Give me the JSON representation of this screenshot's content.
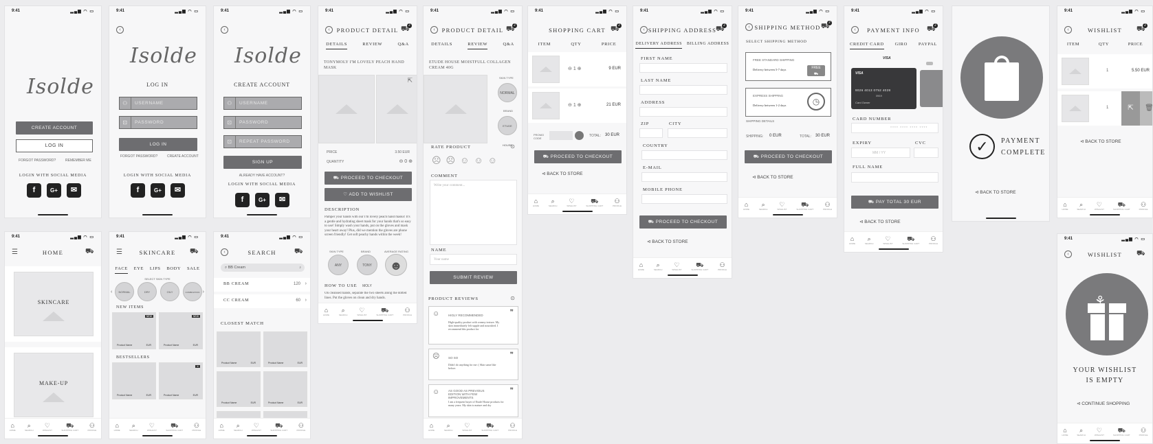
{
  "status_time": "9:41",
  "nav": [
    "HOME",
    "SEARCH",
    "WISHLIST",
    "SHOPPING CART",
    "PROFILE"
  ],
  "splash": {
    "logo": "Isolde",
    "create": "CREATE ACCOUNT",
    "login": "LOG IN",
    "forgot": "FORGOT PASSWORD?",
    "remember": "REMEMBER ME",
    "social": "LOGIN WITH SOCIAL MEDIA"
  },
  "login": {
    "title": "LOG IN",
    "username": "USERNAME",
    "password": "PASSWORD",
    "button": "LOG IN",
    "forgot": "FORGOT PASSWORD?",
    "create": "CREATE ACCOUNT",
    "social": "LOGIN WITH SOCIAL MEDIA"
  },
  "signup": {
    "title": "CREATE ACCOUNT",
    "username": "USERNAME",
    "password": "PASSWORD",
    "repeat": "REPEAT PASSWORD",
    "button": "SIGN UP",
    "already": "ALREADY HAVE ACCOUNT?",
    "social": "LOGIN WITH SOCIAL MEDIA"
  },
  "pd1": {
    "title": "PRODUCT DETAIL",
    "tabs": [
      "DETAILS",
      "REVIEW",
      "Q&A"
    ],
    "name": "TONYMOLY I'M LOVELY PEACH HAND MASK",
    "price_l": "PRICE",
    "price": "3.50 EUR",
    "qty_l": "QUANTITY",
    "qty": "0",
    "checkout": "PROCEED TO CHECKOUT",
    "wishlist": "ADD TO WISHLIST",
    "desc_h": "DESCRIPTION",
    "desc": "Pamper your hands with our I'm lovely peach hand masks! It's a gentle and hydrating sheet mask for your hands that's so easy to use! Simply wash your hands, put on the gloves and mask your heart away! Plus, did we mention the gloves are phone screen friendly! Get soft peachy hands within the week!",
    "attrs": [
      "SKIN TYPE",
      "BRAND",
      "AVERAGE RATING"
    ],
    "vals": [
      "ANY",
      "TONY MOLY"
    ],
    "how_h": "HOW TO USE",
    "how": "On cleansed hands, separate the two sheets along the dotted lines. Put the gloves on clean and dry hands."
  },
  "pd2": {
    "title": "PRODUCT DETAIL",
    "tabs": [
      "DETAILS",
      "REVIEW",
      "Q&A"
    ],
    "name": "ETUDE HOUSE MOISTFULL COLLAGEN CREAM 40G",
    "skin": "SKIN TYPE",
    "skin_v": "NORMAL",
    "brand": "BRAND",
    "brand_v": "ETUDE HOUSE",
    "rate": "RATE PRODUCT",
    "comment": "COMMENT",
    "comment_ph": "Write your comment...",
    "name_l": "NAME",
    "name_ph": "Your name",
    "submit": "SUBMIT REVIEW",
    "reviews_h": "PRODUCT REVIEWS",
    "reviews": [
      {
        "t": "HIGLY RECOMMENDED",
        "b": "High-quality product with creamy texture. My skin immediately felt supple and nourished. I recommend this product for"
      },
      {
        "t": "SO SO",
        "b": "Didn't do anything for me :( Skin same like before."
      },
      {
        "t": "AS GOOD AS PREVIOUS EDITION WITH FEW IMPROVEMENTS",
        "b": "I am a frequent buyer of Etude House products for many years. My skin is mature and dry"
      }
    ]
  },
  "cart": {
    "title": "SHOPPING CART",
    "cols": [
      "ITEM",
      "QTY",
      "PRICE"
    ],
    "items": [
      {
        "qty": "1",
        "price": "9 EUR"
      },
      {
        "qty": "1",
        "price": "21 EUR"
      }
    ],
    "promo": "PROMO CODE",
    "total_l": "TOTAL:",
    "total": "30 EUR",
    "checkout": "PROCEED TO CHECKOUT",
    "back": "BACK TO STORE"
  },
  "addr": {
    "title": "SHIPPING ADDRESS",
    "tabs": [
      "DELIVERY ADDRESS",
      "BILLING ADDRESS"
    ],
    "fields": [
      "FIRST NAME",
      "LAST NAME",
      "ADDRESS",
      "ZIP",
      "CITY",
      "COUNTRY",
      "E-MAIL",
      "MOBILE PHONE"
    ],
    "checkout": "PROCEED TO CHECKOUT",
    "back": "BACK TO STORE"
  },
  "method": {
    "title": "SHIPPING METHOD",
    "select": "SELECT SHIPPING METHOD",
    "free": "FREE STANDARD SHIPPING",
    "free_d": "Delivery between 5-7 days",
    "free_badge": "FREE",
    "express": "EXPRESS SHIPPING",
    "express_d": "Delivery between 1-2 days",
    "details": "SHIPPING DETAILS",
    "ship_l": "SHIPPING:",
    "ship": "0 EUR",
    "total_l": "TOTAL:",
    "total": "30 EUR",
    "checkout": "PROCEED TO CHECKOUT",
    "back": "BACK TO STORE"
  },
  "pay": {
    "title": "PAYMENT INFO",
    "tabs": [
      "CREDIT CARD",
      "GIRO",
      "PAYPAL"
    ],
    "card_brand": "VISA",
    "card_num": "9026  4013  0752  4028",
    "card_holder": "Card Owner",
    "card_exp": "09/19",
    "num_l": "CARD NUMBER",
    "num_ph": "**** **** **** ****",
    "exp_l": "EXPIRY",
    "exp_ph": "MM  /  YY",
    "cvc_l": "CVC",
    "name_l": "FULL NAME",
    "pay": "PAY TOTAL 30 EUR",
    "back": "BACK TO STORE"
  },
  "done": {
    "line1": "PAYMENT",
    "line2": "COMPLETE",
    "back": "BACK TO STORE"
  },
  "wish": {
    "title": "WISHLIST",
    "cols": [
      "ITEM",
      "QTY",
      "PRICE"
    ],
    "items": [
      {
        "qty": "1",
        "price": "5.50 EUR"
      },
      {
        "qty": "1"
      }
    ],
    "back": "BACK TO STORE"
  },
  "home": {
    "title": "HOME",
    "cards": [
      "SKINCARE",
      "MAKE-UP"
    ]
  },
  "skin": {
    "title": "SKINCARE",
    "cats": [
      "FACE",
      "EYE",
      "LIPS",
      "BODY",
      "SALE"
    ],
    "select": "SELECT SKIN TYPE",
    "types": [
      "NORMAL",
      "DRY",
      "OILY",
      "COMBINATION"
    ],
    "new": "NEW ITEMS",
    "best": "BESTSELLERS",
    "badge": "NEW",
    "pname": "Product Name",
    "eur": "EUR"
  },
  "search": {
    "title": "SEARCH",
    "query": "BB Cream",
    "results": [
      {
        "n": "BB CREAM",
        "c": "120"
      },
      {
        "n": "CC CREAM",
        "c": "60"
      }
    ],
    "closest": "CLOSEST MATCH",
    "pname": "Product Name",
    "eur": "EUR"
  },
  "wish_empty": {
    "title": "WISHLIST",
    "line1": "YOUR WISHLIST",
    "line2": "IS EMPTY",
    "cont": "CONTINUE SHOPPING"
  }
}
